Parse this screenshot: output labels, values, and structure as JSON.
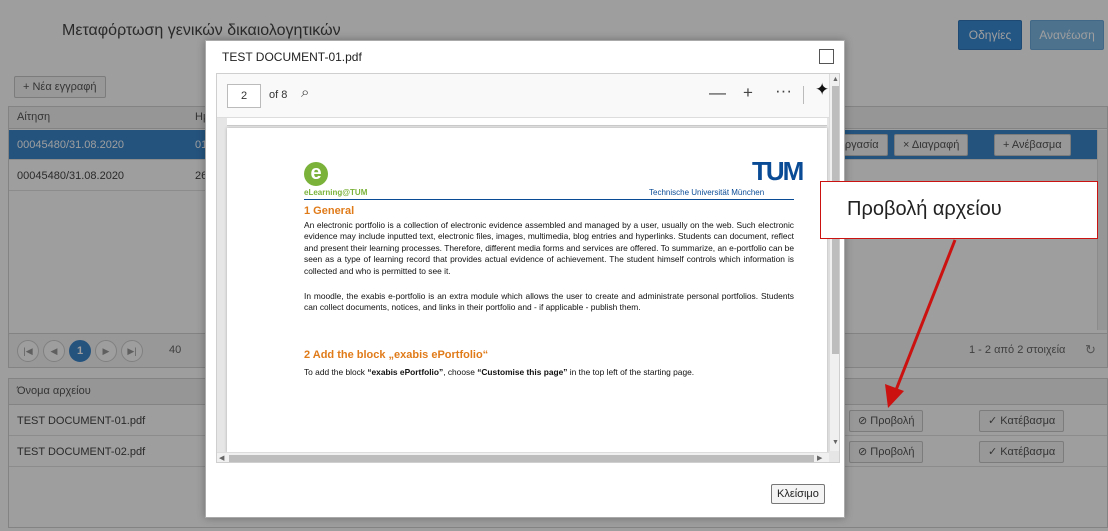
{
  "page": {
    "title": "Μεταφόρτωση γενικών δικαιολογητικών",
    "help_button": "Οδηγίες",
    "refresh_button": "Ανανέωση"
  },
  "applications_grid": {
    "new_entry_button": "+ Νέα εγγραφή",
    "columns": [
      "Αίτηση",
      "Ημ"
    ],
    "rows": [
      {
        "id": "00045480/31.08.2020",
        "date_fragment": "01",
        "selected": true,
        "actions": [
          "εργασία",
          "× Διαγραφή",
          "+ Ανέβασμα"
        ]
      },
      {
        "id": "00045480/31.08.2020",
        "date_fragment": "26",
        "selected": false
      }
    ],
    "pager": {
      "current_page": "1",
      "page_size": "40",
      "summary": "1 - 2 από 2 στοιχεία"
    }
  },
  "files_grid": {
    "column": "Όνομα αρχείου",
    "rows": [
      {
        "name": "TEST DOCUMENT-01.pdf",
        "view_label": "Προβολή",
        "download_label": "Κατέβασμα"
      },
      {
        "name": "TEST DOCUMENT-02.pdf",
        "view_label": "Προβολή",
        "download_label": "Κατέβασμα"
      }
    ]
  },
  "modal": {
    "title": "TEST DOCUMENT-01.pdf",
    "close_button": "Κλείσιμο",
    "viewer": {
      "page_number": "2",
      "page_total": "of 8",
      "document": {
        "left_logo_text": "eLearning@TUM",
        "right_logo": "TUM",
        "right_logo_text": "Technische Universität München",
        "section1_title": "1   General",
        "section1_para1": "An electronic portfolio is a collection of electronic evidence assembled and managed by a user, usually on the web. Such electronic evidence may include inputted text, electronic files, images, multimedia, blog entries and hyperlinks. Students can document, reflect and present their learning processes. Therefore, different media forms and services are offered. To summarize, an e-portfolio can be seen as a type of learning record that provides actual evidence of achievement. The student himself controls which information is collected and who is permitted to see it.",
        "section1_para2": "In moodle, the exabis e-portfolio is an extra module which allows the user to create and administrate personal portfolios. Students can collect documents, notices, and links in their portfolio and - if applicable - publish them.",
        "section2_title": "2   Add the block „exabis ePortfolio“",
        "section2_para_a": "To add the block ",
        "section2_para_b": "“exabis ePortfolio”",
        "section2_para_c": ", choose ",
        "section2_para_d": "“Customise this page”",
        "section2_para_e": " in the top left of the starting page."
      }
    }
  },
  "callout": {
    "text": "Προβολή αρχείου",
    "border_color": "#cc1111"
  },
  "colors": {
    "accent": "#3a86cc",
    "logo_green": "#7ab23a",
    "tum_blue": "#0a4b96",
    "heading_orange": "#e07b1a"
  }
}
